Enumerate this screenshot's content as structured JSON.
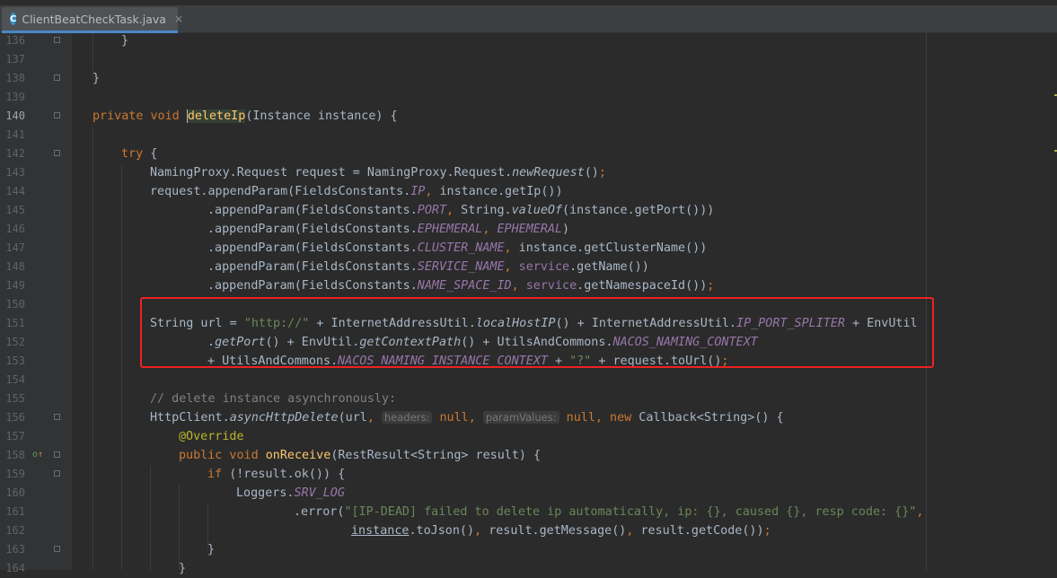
{
  "tab": {
    "icon_letter": "C",
    "filename": "ClientBeatCheckTask.java",
    "close": "×"
  },
  "highlight_color": "#ee2222",
  "lines": [
    {
      "n": "136",
      "indent": 1,
      "seg": [
        {
          "t": "}"
        }
      ]
    },
    {
      "n": "137",
      "indent": 0,
      "seg": []
    },
    {
      "n": "138",
      "indent": 0,
      "seg": [
        {
          "t": "}"
        }
      ]
    },
    {
      "n": "139",
      "indent": 0,
      "seg": []
    },
    {
      "n": "140",
      "indent": 0,
      "current": true,
      "seg": [
        {
          "t": "private void ",
          "c": "k"
        },
        {
          "t": "deleteIp",
          "c": "f caret"
        },
        {
          "t": "(Instance instance) {"
        }
      ]
    },
    {
      "n": "141",
      "indent": 0,
      "seg": []
    },
    {
      "n": "142",
      "indent": 1,
      "seg": [
        {
          "t": "try ",
          "c": "k"
        },
        {
          "t": "{"
        }
      ]
    },
    {
      "n": "143",
      "indent": 2,
      "seg": [
        {
          "t": "NamingProxy.Request request = NamingProxy.Request."
        },
        {
          "t": "newRequest",
          "c": "m"
        },
        {
          "t": "()"
        },
        {
          "t": ";",
          "c": "k"
        }
      ]
    },
    {
      "n": "144",
      "indent": 2,
      "seg": [
        {
          "t": "request.appendParam(FieldsConstants."
        },
        {
          "t": "IP",
          "c": "i"
        },
        {
          "t": ", ",
          "c": "k"
        },
        {
          "t": "instance.getIp())"
        }
      ]
    },
    {
      "n": "145",
      "indent": 4,
      "seg": [
        {
          "t": ".appendParam(FieldsConstants."
        },
        {
          "t": "PORT",
          "c": "i"
        },
        {
          "t": ", ",
          "c": "k"
        },
        {
          "t": "String."
        },
        {
          "t": "valueOf",
          "c": "m"
        },
        {
          "t": "(instance.getPort()))"
        }
      ]
    },
    {
      "n": "146",
      "indent": 4,
      "seg": [
        {
          "t": ".appendParam(FieldsConstants."
        },
        {
          "t": "EPHEMERAL",
          "c": "i"
        },
        {
          "t": ", ",
          "c": "k"
        },
        {
          "t": "EPHEMERAL",
          "c": "i"
        },
        {
          "t": ")"
        }
      ]
    },
    {
      "n": "147",
      "indent": 4,
      "seg": [
        {
          "t": ".appendParam(FieldsConstants."
        },
        {
          "t": "CLUSTER_NAME",
          "c": "i"
        },
        {
          "t": ", ",
          "c": "k"
        },
        {
          "t": "instance.getClusterName())"
        }
      ]
    },
    {
      "n": "148",
      "indent": 4,
      "seg": [
        {
          "t": ".appendParam(FieldsConstants."
        },
        {
          "t": "SERVICE_NAME",
          "c": "i"
        },
        {
          "t": ", ",
          "c": "k"
        },
        {
          "t": "service",
          "c": "v"
        },
        {
          "t": ".getName())"
        }
      ]
    },
    {
      "n": "149",
      "indent": 4,
      "seg": [
        {
          "t": ".appendParam(FieldsConstants."
        },
        {
          "t": "NAME_SPACE_ID",
          "c": "i"
        },
        {
          "t": ", ",
          "c": "k"
        },
        {
          "t": "service",
          "c": "v"
        },
        {
          "t": ".getNamespaceId())"
        },
        {
          "t": ";",
          "c": "k"
        }
      ]
    },
    {
      "n": "150",
      "indent": 0,
      "seg": []
    },
    {
      "n": "151",
      "indent": 2,
      "seg": [
        {
          "t": "String url = "
        },
        {
          "t": "\"http://\"",
          "c": "s"
        },
        {
          "t": " + InternetAddressUtil."
        },
        {
          "t": "localHostIP",
          "c": "m"
        },
        {
          "t": "() + InternetAddressUtil."
        },
        {
          "t": "IP_PORT_SPLITER",
          "c": "i"
        },
        {
          "t": " + EnvUtil"
        }
      ]
    },
    {
      "n": "152",
      "indent": 4,
      "seg": [
        {
          "t": "."
        },
        {
          "t": "getPort",
          "c": "m"
        },
        {
          "t": "() + EnvUtil."
        },
        {
          "t": "getContextPath",
          "c": "m"
        },
        {
          "t": "() + UtilsAndCommons."
        },
        {
          "t": "NACOS_NAMING_CONTEXT",
          "c": "i"
        }
      ]
    },
    {
      "n": "153",
      "indent": 4,
      "seg": [
        {
          "t": "+ UtilsAndCommons."
        },
        {
          "t": "NACOS_NAMING_INSTANCE_CONTEXT",
          "c": "i"
        },
        {
          "t": " + "
        },
        {
          "t": "\"?\"",
          "c": "s"
        },
        {
          "t": " + request.toUrl()"
        },
        {
          "t": ";",
          "c": "k"
        }
      ]
    },
    {
      "n": "154",
      "indent": 0,
      "seg": []
    },
    {
      "n": "155",
      "indent": 2,
      "seg": [
        {
          "t": "// delete instance asynchronously:",
          "c": "c"
        }
      ]
    },
    {
      "n": "156",
      "indent": 2,
      "seg": [
        {
          "t": "HttpClient."
        },
        {
          "t": "asyncHttpDelete",
          "c": "m"
        },
        {
          "t": "(url"
        },
        {
          "t": ", ",
          "c": "k"
        },
        {
          "t": "headers:",
          "c": "hint"
        },
        {
          "t": " "
        },
        {
          "t": "null",
          "c": "k"
        },
        {
          "t": ", ",
          "c": "k"
        },
        {
          "t": "paramValues:",
          "c": "hint"
        },
        {
          "t": " "
        },
        {
          "t": "null",
          "c": "k"
        },
        {
          "t": ", new ",
          "c": "k"
        },
        {
          "t": "Callback<String>() {"
        }
      ]
    },
    {
      "n": "157",
      "indent": 3,
      "seg": [
        {
          "t": "@Override",
          "c": "a"
        }
      ]
    },
    {
      "n": "158",
      "indent": 3,
      "impl": "o↑",
      "seg": [
        {
          "t": "public void ",
          "c": "k"
        },
        {
          "t": "onReceive",
          "c": "f"
        },
        {
          "t": "(RestResult<String> result) {"
        }
      ]
    },
    {
      "n": "159",
      "indent": 4,
      "seg": [
        {
          "t": "if ",
          "c": "k"
        },
        {
          "t": "(!result.ok()) {"
        }
      ]
    },
    {
      "n": "160",
      "indent": 5,
      "seg": [
        {
          "t": "Loggers."
        },
        {
          "t": "SRV_LOG",
          "c": "i"
        }
      ]
    },
    {
      "n": "161",
      "indent": 7,
      "seg": [
        {
          "t": ".error("
        },
        {
          "t": "\"[IP-DEAD] failed to delete ip automatically, ip: {}, caused {}, resp code: {}\"",
          "c": "s"
        },
        {
          "t": ",",
          "c": "k"
        }
      ]
    },
    {
      "n": "162",
      "indent": 9,
      "seg": [
        {
          "t": "instance",
          "c": "u"
        },
        {
          "t": ".toJson()"
        },
        {
          "t": ", ",
          "c": "k"
        },
        {
          "t": "result.getMessage()"
        },
        {
          "t": ", ",
          "c": "k"
        },
        {
          "t": "result.getCode())"
        },
        {
          "t": ";",
          "c": "k"
        }
      ]
    },
    {
      "n": "163",
      "indent": 4,
      "seg": [
        {
          "t": "}"
        }
      ]
    },
    {
      "n": "164",
      "indent": 3,
      "seg": [
        {
          "t": "}"
        }
      ]
    }
  ]
}
